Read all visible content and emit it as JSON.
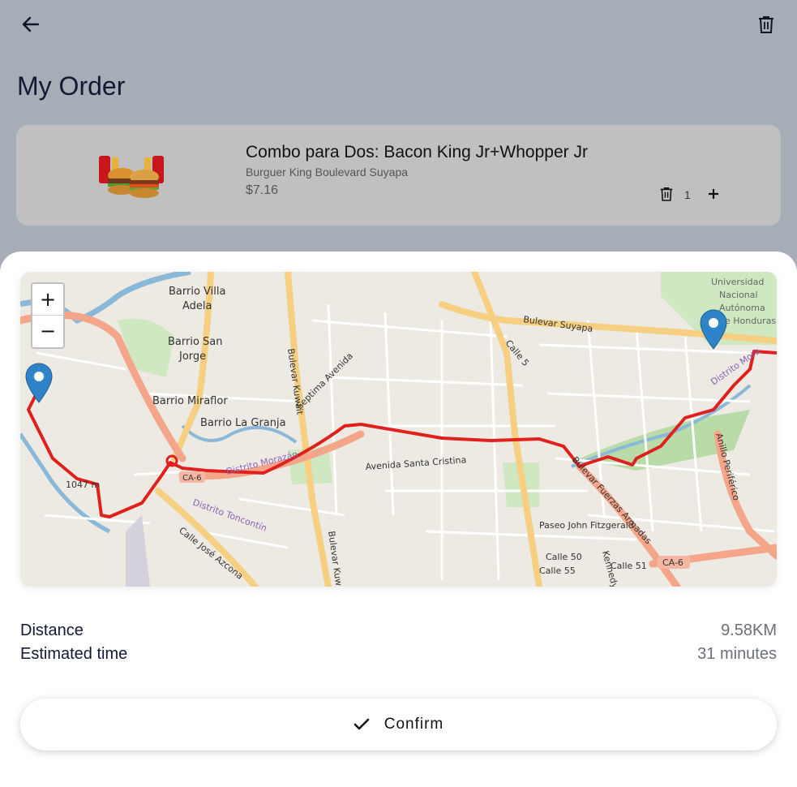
{
  "header": {
    "title": "My Order",
    "back_icon": "arrow-left-icon",
    "trash_icon": "trash-icon"
  },
  "order": {
    "items": [
      {
        "title": "Combo para Dos: Bacon King Jr+Whopper Jr",
        "store": "Burguer King Boulevard Suyapa",
        "price": "$7.16",
        "quantity": "1"
      }
    ]
  },
  "map": {
    "zoom_in": "+",
    "zoom_out": "−",
    "labels": [
      "Barrio Villa",
      "Adela",
      "Barrio San",
      "Jorge",
      "Barrio Miraflor",
      "Barrio La Granja",
      "Bulevar Suyapa",
      "Universidad",
      "Nacional",
      "Autónoma",
      "de Honduras",
      "Septima Avenida",
      "Bulevar Kuwait",
      "Avenida Santa Cristina",
      "Distrito Morazán",
      "Distrito Toncontín",
      "Calle José Azcona",
      "Bulevar Fuerzas Armadas",
      "Paseo John Fitzgerald Kennedy",
      "Calle 50",
      "Calle 51",
      "Calle 55",
      "CA-6",
      "Anillo Periférico",
      "Distrito Mora",
      "Calle 5",
      "1047 m",
      "CA-6"
    ],
    "route_color": "#e0201c",
    "marker_color": "#2f83c9"
  },
  "summary": {
    "distance_label": "Distance",
    "distance_value": "9.58KM",
    "time_label": "Estimated time",
    "time_value": "31 minutes"
  },
  "confirm": {
    "label": "Confirm",
    "icon": "check-icon"
  }
}
